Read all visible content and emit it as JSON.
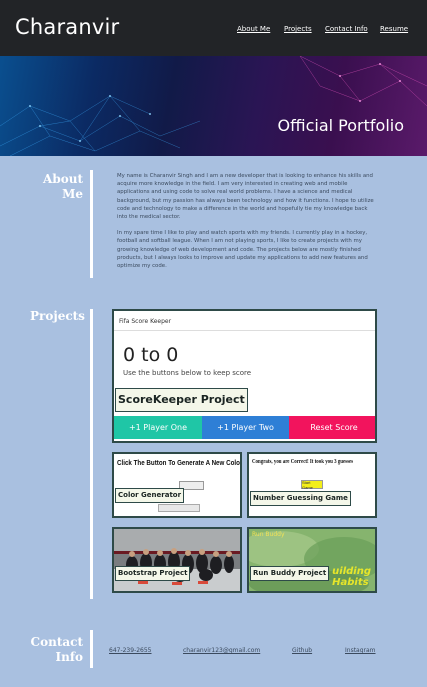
{
  "header": {
    "brand": "Charanvir",
    "nav": [
      {
        "label": "About Me"
      },
      {
        "label": "Projects"
      },
      {
        "label": "Contact Info"
      },
      {
        "label": "Resume"
      }
    ]
  },
  "hero": {
    "title": "Official Portfolio"
  },
  "about": {
    "heading_line1": "About",
    "heading_line2": "Me",
    "paragraph1": "My name is Charanvir Singh and I am a new developer that is looking to enhance his skills and acquire more knowledge in the field. I am very interested in creating web and mobile applications and using code to solve real world problems. I have a science and medical background, but my passion has always been technology and how it functions. I hope to utilize code and technology to make a difference in the world and hopefully tie my knowledge back into the medical sector.",
    "paragraph2": "In my spare time I like to play and watch sports with my friends. I currently play in a hockey, football and softball league. When I am not playing sports, I like to create projects with my growing knowledge of web development and code. The projects below are mostly finished products, but I always looks to improve and update my applications to add new features and optimize my code."
  },
  "projects": {
    "heading": "Projects",
    "scorekeeper": {
      "app_title": "Fifa Score Keeper",
      "score": "0 to 0",
      "hint": "Use the buttons below to keep score",
      "tag": "ScoreKeeper Project",
      "buttons": [
        "+1 Player One",
        "+1 Player Two",
        "Reset Score"
      ],
      "colors": [
        "#1fc6a6",
        "#2e7fd6",
        "#f2145d"
      ]
    },
    "color_generator": {
      "heading": "Click The Button To Generate A New Color",
      "tag": "Color Generator"
    },
    "number_guessing": {
      "heading": "Congrats, you are Correct! It took you 3 guesses",
      "start": "Start Game",
      "tag": "Number Guessing Game"
    },
    "bootstrap": {
      "tag": "Bootstrap Project"
    },
    "run_buddy": {
      "corner": "Run Buddy",
      "tag": "Run Buddy Project",
      "slogan_line1": "uilding",
      "slogan_line2": "Habits"
    }
  },
  "contact": {
    "heading_line1": "Contact",
    "heading_line2": "Info",
    "links": [
      {
        "label": "647-239-2655"
      },
      {
        "label": "charanvir123@gmail.com"
      },
      {
        "label": "Github"
      },
      {
        "label": "Instagram"
      }
    ]
  }
}
